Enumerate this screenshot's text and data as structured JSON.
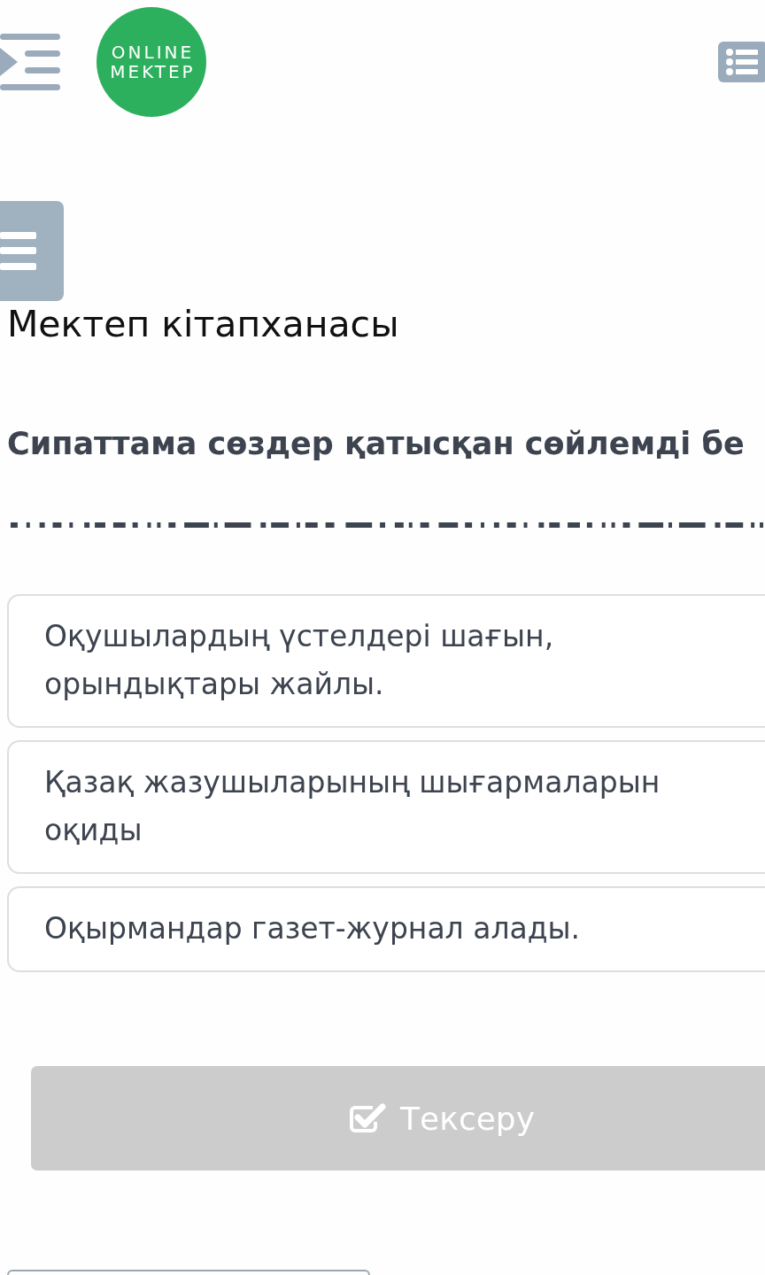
{
  "header": {
    "logo": {
      "line_1": "ONLINE",
      "line_2": "MEKTEP"
    }
  },
  "lesson_title": "Мектеп кітапханасы",
  "question": {
    "text": "Сипаттама сөздер қатысқан сөйлемді бе"
  },
  "options": [
    {
      "text": "Оқушылардың үстелдері шағын, орындықтары жайлы.",
      "selected": false
    },
    {
      "text": "Қазақ жазушыларының шығармаларын оқиды",
      "selected": false
    },
    {
      "text": "Оқырмандар газет-журнал алады.",
      "selected": false
    }
  ],
  "check_button": {
    "label": "Тексеру",
    "disabled": true
  }
}
